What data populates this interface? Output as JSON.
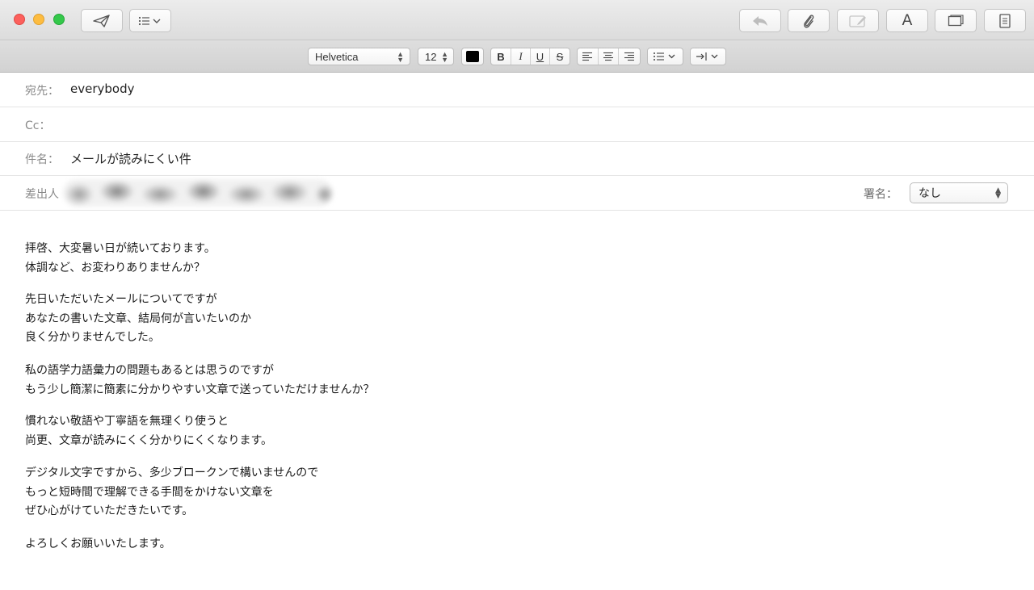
{
  "toolbar": {
    "send_icon": "paper-plane-icon",
    "header_fields_icon": "list-dropdown-icon",
    "reply_icon": "reply-arrow-icon",
    "attach_icon": "paperclip-icon",
    "markup_icon": "markup-icon",
    "format_icon": "font-a-icon",
    "photo_icon": "photo-browser-icon",
    "stationery_icon": "stationery-icon",
    "format_label": "A"
  },
  "formatbar": {
    "font_family": "Helvetica",
    "font_size": "12",
    "text_color": "#000000",
    "bold": "B",
    "italic": "I",
    "underline": "U",
    "strike": "S"
  },
  "fields": {
    "to_label": "宛先：",
    "to_value": "everybody",
    "cc_label": "Cc：",
    "cc_value": "",
    "subject_label": "件名：",
    "subject_value": "メールが読みにくい件",
    "from_label": "差出人",
    "signature_label": "署名：",
    "signature_value": "なし"
  },
  "body": {
    "paragraphs": [
      [
        "拝啓、大変暑い日が続いております。",
        "体調など、お変わりありませんか？"
      ],
      [
        "先日いただいたメールについてですが",
        "あなたの書いた文章、結局何が言いたいのか",
        "良く分かりませんでした。"
      ],
      [
        "私の語学力語彙力の問題もあるとは思うのですが",
        "もう少し簡潔に簡素に分かりやすい文章で送っていただけませんか？"
      ],
      [
        "慣れない敬語や丁寧語を無理くり使うと",
        "尚更、文章が読みにくく分かりにくくなります。"
      ],
      [
        "デジタル文字ですから、多少ブロークンで構いませんので",
        "もっと短時間で理解できる手間をかけない文章を",
        "ぜひ心がけていただきたいです。"
      ],
      [
        "よろしくお願いいたします。"
      ]
    ]
  }
}
